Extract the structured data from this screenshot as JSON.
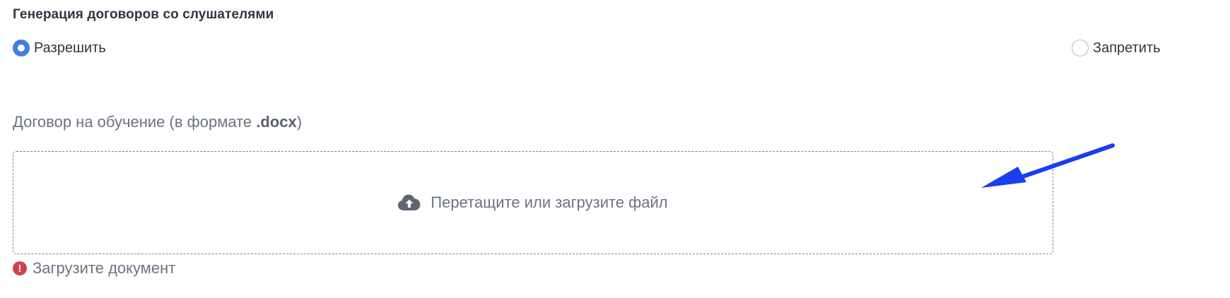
{
  "section": {
    "title": "Генерация договоров со слушателями"
  },
  "radio": {
    "allow_label": "Разрешить",
    "deny_label": "Запретить",
    "selected": "allow"
  },
  "contract_field": {
    "label_prefix": "Договор на обучение (в формате ",
    "label_format": ".docx",
    "label_suffix": ")"
  },
  "dropzone": {
    "text": "Перетащите или загрузите файл",
    "icon": "cloud-upload-icon"
  },
  "error": {
    "icon": "exclamation-circle-icon",
    "icon_glyph": "!",
    "text": "Загрузите документ"
  },
  "colors": {
    "accent": "#3f7fe6",
    "error": "#d2404f",
    "annotation_arrow": "#1a3df0",
    "text_muted": "#6b7380",
    "text_dark": "#2f3542"
  }
}
